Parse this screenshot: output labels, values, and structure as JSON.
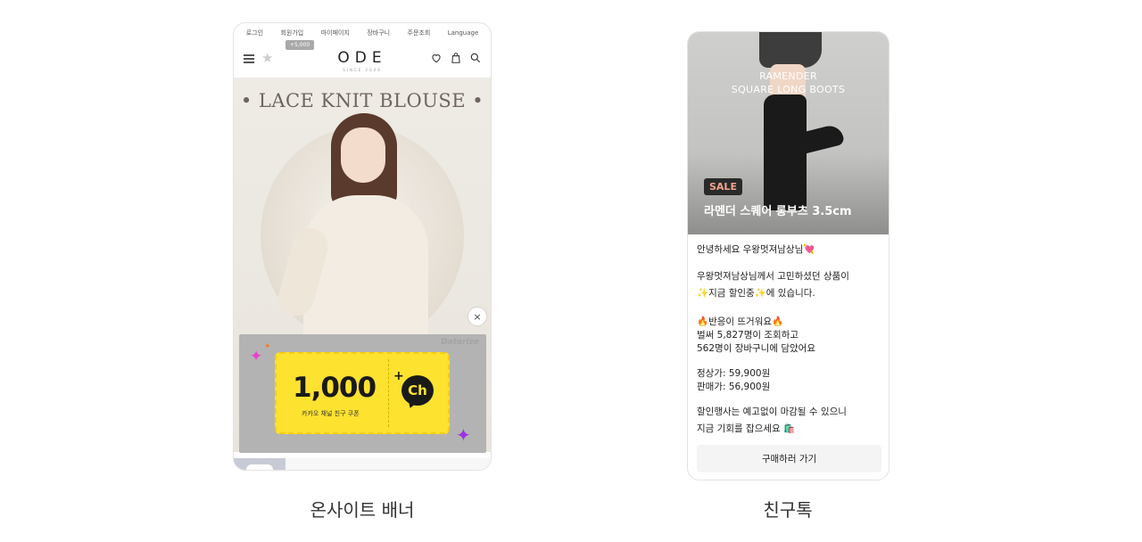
{
  "left_phone": {
    "top_nav": [
      "로그인",
      "회원가입",
      "마이페이지",
      "장바구니",
      "주문조회",
      "Language"
    ],
    "point_badge": "+5,000",
    "logo": "ODE",
    "logo_sub": "SINCE 2009",
    "hero_title": "• LACE KNIT BLOUSE •",
    "close_icon": "×",
    "coupon": {
      "brand": "Datarize",
      "amount": "1,000",
      "label": "카카오 채널 친구 쿠폰",
      "channel_icon_text": "Ch",
      "plus": "+"
    },
    "caption": "온사이트 배너"
  },
  "right_phone": {
    "banner_title_line1": "RAMENDER",
    "banner_title_line2": "SQUARE LONG BOOTS",
    "sale_badge": "SALE",
    "product_name": "라멘더 스퀘어 롱부츠 3.5cm",
    "greeting": "안녕하세요 우왕멋져남상님💘",
    "line1": "우왕멋져남상님께서 고민하셨던  상품이",
    "line2": "✨지금 할인중✨에 있습니다.",
    "line3": "🔥반응이 뜨거워요🔥",
    "line4": "벌써 5,827명이 조회하고",
    "line5": "562명이 장바구니에 담았어요",
    "price_regular": "정상가: 59,900원",
    "price_sale": "판매가: 56,900원",
    "line6": "할인행사는 예고없이 마감될 수 있으니",
    "line7": "지금 기회를 잡으세요 🛍️",
    "cta": "구매하러 가기",
    "caption": "친구톡"
  },
  "colors": {
    "coupon_yellow": "#fde230",
    "panel_gray": "#b3b3b3",
    "sale_text": "#f2a48e",
    "spark_pink": "#e83fd2",
    "spark_purple": "#9b32e0",
    "spark_orange": "#ff7a1a"
  },
  "icons": [
    "hamburger-icon",
    "star-icon",
    "heart-icon",
    "bag-icon",
    "search-icon",
    "close-icon",
    "kakao-channel-icon",
    "sparkle-icon"
  ]
}
